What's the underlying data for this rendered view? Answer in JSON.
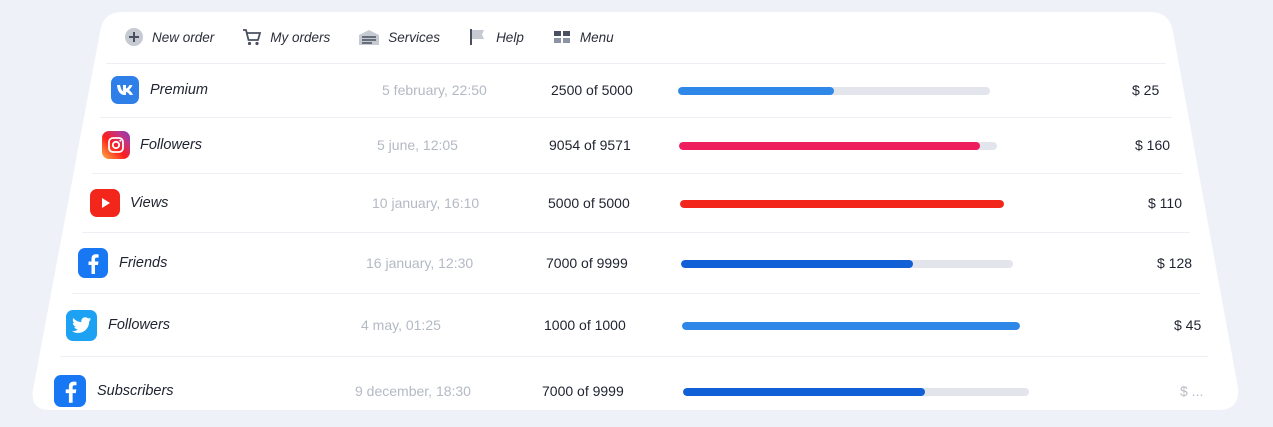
{
  "nav": [
    {
      "label": "New order",
      "icon": "plus-circle-icon"
    },
    {
      "label": "My orders",
      "icon": "cart-icon"
    },
    {
      "label": "Services",
      "icon": "services-icon"
    },
    {
      "label": "Help",
      "icon": "flag-icon"
    },
    {
      "label": "Menu",
      "icon": "grid-icon"
    }
  ],
  "orders": [
    {
      "service": "vk",
      "label": "Premium",
      "date": "5 february, 22:50",
      "count": "2500 of 5000",
      "progress": 0.5,
      "color": "#2f88e8",
      "price": "$ 25"
    },
    {
      "service": "instagram",
      "label": "Followers",
      "date": "5 june, 12:05",
      "count": "9054 of 9571",
      "progress": 0.946,
      "color": "#ee1e5e",
      "price": "$ 160"
    },
    {
      "service": "youtube",
      "label": "Views",
      "date": "10 january, 16:10",
      "count": "5000 of 5000",
      "progress": 1.0,
      "color": "#f2261a",
      "price": "$ 110"
    },
    {
      "service": "facebook",
      "label": "Friends",
      "date": "16 january, 12:30",
      "count": "7000 of 9999",
      "progress": 0.7,
      "color": "#1260d6",
      "price": "$ 128"
    },
    {
      "service": "twitter",
      "label": "Followers",
      "date": "4 may, 01:25",
      "count": "1000 of 1000",
      "progress": 1.0,
      "color": "#2f88e8",
      "price": "$ 45"
    },
    {
      "service": "facebook",
      "label": "Subscribers",
      "date": "9 december, 18:30",
      "count": "7000 of 9999",
      "progress": 0.7,
      "color": "#1260d6",
      "price": "$ ..."
    }
  ],
  "colors": {
    "vk": "#2f7fe8",
    "youtube": "#f2261a",
    "facebook": "#1877f2",
    "twitter": "#1da1f2"
  }
}
